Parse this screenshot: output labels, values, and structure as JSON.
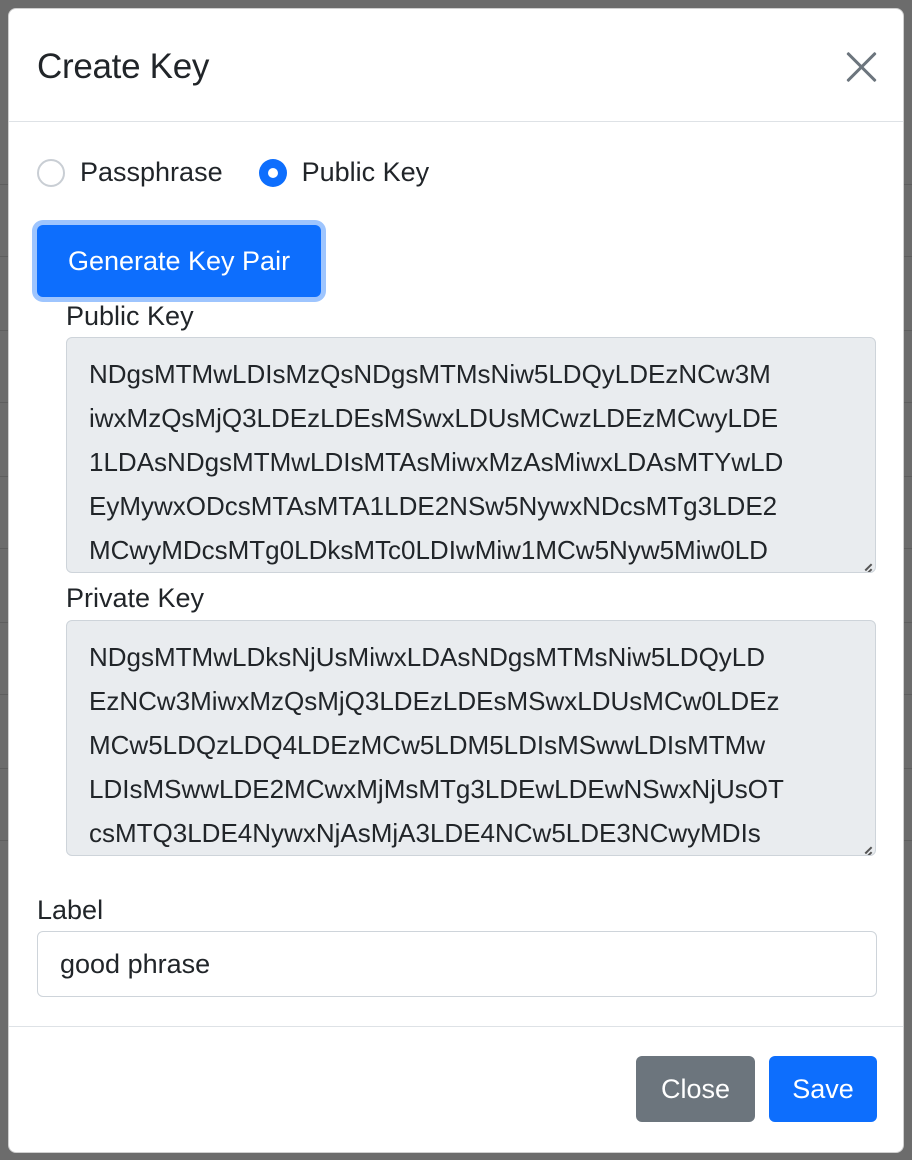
{
  "dialog": {
    "title": "Create Key",
    "close_icon": "close-icon"
  },
  "key_type": {
    "options": [
      {
        "label": "Passphrase",
        "checked": false
      },
      {
        "label": "Public Key",
        "checked": true
      }
    ]
  },
  "generate_button": "Generate Key Pair",
  "public_key": {
    "label": "Public Key",
    "lines": [
      "NDgsMTMwLDIsMzQsNDgsMTMsNiw5LDQyLDEzNCw3M",
      "iwxMzQsMjQ3LDEzLDEsMSwxLDUsMCwzLDEzMCwyLDE",
      "1LDAsNDgsMTMwLDIsMTAsMiwxMzAsMiwxLDAsMTYwLD",
      "EyMywxODcsMTAsMTA1LDE2NSw5NywxNDcsMTg3LDE2",
      "MCwyMDcsMTg0LDksMTc0LDIwMiw1MCw5Nyw5Miw0LD"
    ]
  },
  "private_key": {
    "label": "Private Key",
    "lines": [
      "NDgsMTMwLDksNjUsMiwxLDAsNDgsMTMsNiw5LDQyLD",
      "EzNCw3MiwxMzQsMjQ3LDEzLDEsMSwxLDUsMCw0LDEz",
      "MCw5LDQzLDQ4LDEzMCw5LDM5LDIsMSwwLDIsMTMw",
      "LDIsMSwwLDE2MCwxMjMsMTg3LDEwLDEwNSwxNjUsOT",
      "csMTQ3LDE4NywxNjAsMjA3LDE4NCw5LDE3NCwyMDIs"
    ]
  },
  "label_field": {
    "label": "Label",
    "value": "good phrase"
  },
  "footer": {
    "close_label": "Close",
    "save_label": "Save"
  },
  "colors": {
    "primary": "#0d6efd",
    "secondary": "#6c757d",
    "readonly_bg": "#e9ecef"
  }
}
